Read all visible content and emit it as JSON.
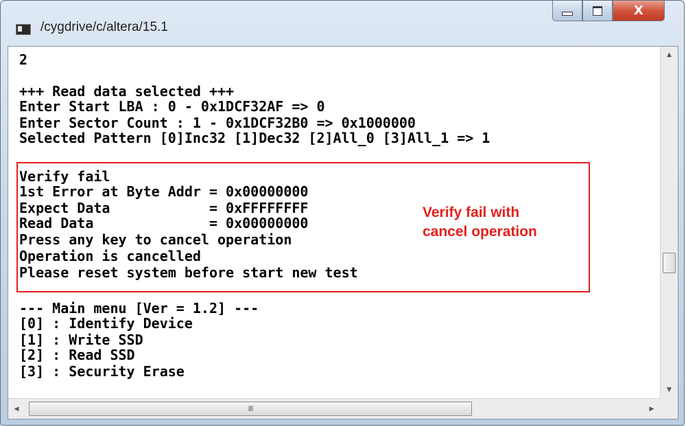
{
  "window": {
    "title": "/cygdrive/c/altera/15.1",
    "minimize_icon": "minimize-icon",
    "maximize_icon": "maximize-icon",
    "close_glyph": "X"
  },
  "console": {
    "lines": [
      "2",
      "",
      "+++ Read data selected +++",
      "Enter Start LBA : 0 - 0x1DCF32AF => 0",
      "Enter Sector Count : 1 - 0x1DCF32B0 => 0x1000000",
      "Selected Pattern [0]Inc32 [1]Dec32 [2]All_0 [3]All_1 => 1",
      "",
      "Verify fail",
      "1st Error at Byte Addr = 0x00000000",
      "Expect Data            = 0xFFFFFFFF",
      "Read Data              = 0x00000000",
      "Press any key to cancel operation",
      "Operation is cancelled",
      "Please reset system before start new test",
      "",
      "--- Main menu [Ver = 1.2] ---",
      "[0] : Identify Device",
      "[1] : Write SSD",
      "[2] : Read SSD",
      "[3] : Security Erase"
    ]
  },
  "annotation": {
    "line1": "Verify fail with",
    "line2": "cancel operation",
    "color": "#e4211c"
  },
  "scrollbars": {
    "up_arrow": "▲",
    "down_arrow": "▼",
    "left_arrow": "◀",
    "right_arrow": "▶",
    "h_thumb_grip": "III"
  }
}
